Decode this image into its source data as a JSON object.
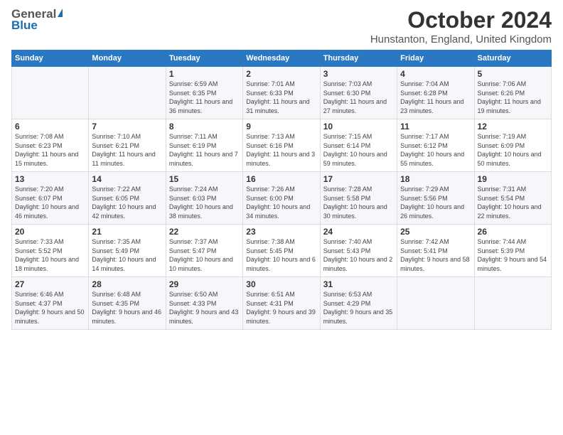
{
  "logo": {
    "general": "General",
    "blue": "Blue"
  },
  "header": {
    "title": "October 2024",
    "location": "Hunstanton, England, United Kingdom"
  },
  "weekdays": [
    "Sunday",
    "Monday",
    "Tuesday",
    "Wednesday",
    "Thursday",
    "Friday",
    "Saturday"
  ],
  "weeks": [
    [
      {
        "day": "",
        "info": ""
      },
      {
        "day": "",
        "info": ""
      },
      {
        "day": "1",
        "info": "Sunrise: 6:59 AM\nSunset: 6:35 PM\nDaylight: 11 hours and 36 minutes."
      },
      {
        "day": "2",
        "info": "Sunrise: 7:01 AM\nSunset: 6:33 PM\nDaylight: 11 hours and 31 minutes."
      },
      {
        "day": "3",
        "info": "Sunrise: 7:03 AM\nSunset: 6:30 PM\nDaylight: 11 hours and 27 minutes."
      },
      {
        "day": "4",
        "info": "Sunrise: 7:04 AM\nSunset: 6:28 PM\nDaylight: 11 hours and 23 minutes."
      },
      {
        "day": "5",
        "info": "Sunrise: 7:06 AM\nSunset: 6:26 PM\nDaylight: 11 hours and 19 minutes."
      }
    ],
    [
      {
        "day": "6",
        "info": "Sunrise: 7:08 AM\nSunset: 6:23 PM\nDaylight: 11 hours and 15 minutes."
      },
      {
        "day": "7",
        "info": "Sunrise: 7:10 AM\nSunset: 6:21 PM\nDaylight: 11 hours and 11 minutes."
      },
      {
        "day": "8",
        "info": "Sunrise: 7:11 AM\nSunset: 6:19 PM\nDaylight: 11 hours and 7 minutes."
      },
      {
        "day": "9",
        "info": "Sunrise: 7:13 AM\nSunset: 6:16 PM\nDaylight: 11 hours and 3 minutes."
      },
      {
        "day": "10",
        "info": "Sunrise: 7:15 AM\nSunset: 6:14 PM\nDaylight: 10 hours and 59 minutes."
      },
      {
        "day": "11",
        "info": "Sunrise: 7:17 AM\nSunset: 6:12 PM\nDaylight: 10 hours and 55 minutes."
      },
      {
        "day": "12",
        "info": "Sunrise: 7:19 AM\nSunset: 6:09 PM\nDaylight: 10 hours and 50 minutes."
      }
    ],
    [
      {
        "day": "13",
        "info": "Sunrise: 7:20 AM\nSunset: 6:07 PM\nDaylight: 10 hours and 46 minutes."
      },
      {
        "day": "14",
        "info": "Sunrise: 7:22 AM\nSunset: 6:05 PM\nDaylight: 10 hours and 42 minutes."
      },
      {
        "day": "15",
        "info": "Sunrise: 7:24 AM\nSunset: 6:03 PM\nDaylight: 10 hours and 38 minutes."
      },
      {
        "day": "16",
        "info": "Sunrise: 7:26 AM\nSunset: 6:00 PM\nDaylight: 10 hours and 34 minutes."
      },
      {
        "day": "17",
        "info": "Sunrise: 7:28 AM\nSunset: 5:58 PM\nDaylight: 10 hours and 30 minutes."
      },
      {
        "day": "18",
        "info": "Sunrise: 7:29 AM\nSunset: 5:56 PM\nDaylight: 10 hours and 26 minutes."
      },
      {
        "day": "19",
        "info": "Sunrise: 7:31 AM\nSunset: 5:54 PM\nDaylight: 10 hours and 22 minutes."
      }
    ],
    [
      {
        "day": "20",
        "info": "Sunrise: 7:33 AM\nSunset: 5:52 PM\nDaylight: 10 hours and 18 minutes."
      },
      {
        "day": "21",
        "info": "Sunrise: 7:35 AM\nSunset: 5:49 PM\nDaylight: 10 hours and 14 minutes."
      },
      {
        "day": "22",
        "info": "Sunrise: 7:37 AM\nSunset: 5:47 PM\nDaylight: 10 hours and 10 minutes."
      },
      {
        "day": "23",
        "info": "Sunrise: 7:38 AM\nSunset: 5:45 PM\nDaylight: 10 hours and 6 minutes."
      },
      {
        "day": "24",
        "info": "Sunrise: 7:40 AM\nSunset: 5:43 PM\nDaylight: 10 hours and 2 minutes."
      },
      {
        "day": "25",
        "info": "Sunrise: 7:42 AM\nSunset: 5:41 PM\nDaylight: 9 hours and 58 minutes."
      },
      {
        "day": "26",
        "info": "Sunrise: 7:44 AM\nSunset: 5:39 PM\nDaylight: 9 hours and 54 minutes."
      }
    ],
    [
      {
        "day": "27",
        "info": "Sunrise: 6:46 AM\nSunset: 4:37 PM\nDaylight: 9 hours and 50 minutes."
      },
      {
        "day": "28",
        "info": "Sunrise: 6:48 AM\nSunset: 4:35 PM\nDaylight: 9 hours and 46 minutes."
      },
      {
        "day": "29",
        "info": "Sunrise: 6:50 AM\nSunset: 4:33 PM\nDaylight: 9 hours and 43 minutes."
      },
      {
        "day": "30",
        "info": "Sunrise: 6:51 AM\nSunset: 4:31 PM\nDaylight: 9 hours and 39 minutes."
      },
      {
        "day": "31",
        "info": "Sunrise: 6:53 AM\nSunset: 4:29 PM\nDaylight: 9 hours and 35 minutes."
      },
      {
        "day": "",
        "info": ""
      },
      {
        "day": "",
        "info": ""
      }
    ]
  ]
}
